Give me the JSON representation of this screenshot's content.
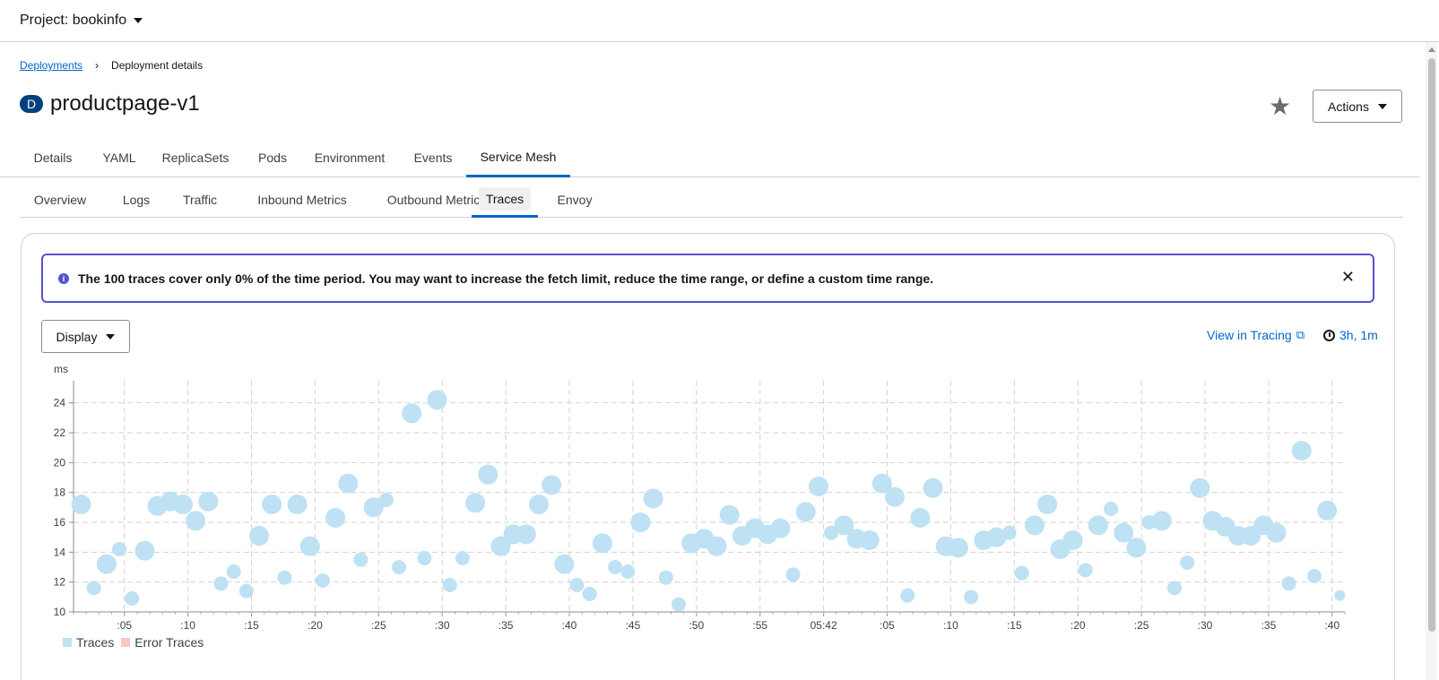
{
  "project": {
    "label": "Project: bookinfo"
  },
  "breadcrumb": {
    "parent": "Deployments",
    "current": "Deployment details"
  },
  "resource": {
    "badge": "D",
    "name": "productpage-v1"
  },
  "actions_label": "Actions",
  "tabs": [
    "Details",
    "YAML",
    "ReplicaSets",
    "Pods",
    "Environment",
    "Events",
    "Service Mesh"
  ],
  "active_tab": "Service Mesh",
  "subtabs": [
    "Overview",
    "Logs",
    "Traffic",
    "Inbound Metrics",
    "Outbound Metrics",
    "Traces",
    "Envoy"
  ],
  "active_subtab": "Traces",
  "alert": {
    "text": "The 100 traces cover only 0% of the time period. You may want to increase the fetch limit, reduce the time range, or define a custom time range."
  },
  "display_label": "Display",
  "tracing_link": "View in Tracing",
  "time_range": "3h, 1m",
  "colors": {
    "accent": "#0066cc",
    "alert_border": "#5752d1",
    "trace_point": "#bee1f4",
    "error_point": "#f9c5c5",
    "badge": "#004080"
  },
  "chart_data": {
    "type": "scatter",
    "ylabel": "ms",
    "ylim": [
      10,
      25
    ],
    "yticks": [
      10,
      12,
      14,
      16,
      18,
      20,
      22,
      24
    ],
    "xlim": [
      0,
      100
    ],
    "xticks": [
      {
        "pos": 4,
        "label": ":05"
      },
      {
        "pos": 9,
        "label": ":10"
      },
      {
        "pos": 14,
        "label": ":15"
      },
      {
        "pos": 19,
        "label": ":20"
      },
      {
        "pos": 24,
        "label": ":25"
      },
      {
        "pos": 29,
        "label": ":30"
      },
      {
        "pos": 34,
        "label": ":35"
      },
      {
        "pos": 39,
        "label": ":40"
      },
      {
        "pos": 44,
        "label": ":45"
      },
      {
        "pos": 49,
        "label": ":50"
      },
      {
        "pos": 54,
        "label": ":55"
      },
      {
        "pos": 59,
        "label": "05:42"
      },
      {
        "pos": 64,
        "label": ":05"
      },
      {
        "pos": 69,
        "label": ":10"
      },
      {
        "pos": 74,
        "label": ":15"
      },
      {
        "pos": 79,
        "label": ":20"
      },
      {
        "pos": 84,
        "label": ":25"
      },
      {
        "pos": 89,
        "label": ":30"
      },
      {
        "pos": 94,
        "label": ":35"
      },
      {
        "pos": 99,
        "label": ":40"
      }
    ],
    "legend": [
      "Traces",
      "Error Traces"
    ],
    "series": [
      {
        "name": "Traces",
        "points": [
          [
            0.6,
            17.2,
            2
          ],
          [
            1.6,
            11.6,
            1
          ],
          [
            2.6,
            13.2,
            2
          ],
          [
            3.6,
            14.2,
            1
          ],
          [
            4.6,
            10.9,
            1
          ],
          [
            5.6,
            14.1,
            2
          ],
          [
            6.6,
            17.1,
            2
          ],
          [
            7.6,
            17.4,
            2
          ],
          [
            8.6,
            17.2,
            2
          ],
          [
            9.6,
            16.1,
            2
          ],
          [
            10.6,
            17.4,
            2
          ],
          [
            11.6,
            11.9,
            1
          ],
          [
            12.6,
            12.7,
            1
          ],
          [
            13.6,
            11.4,
            1
          ],
          [
            14.6,
            15.1,
            2
          ],
          [
            15.6,
            17.2,
            2
          ],
          [
            16.6,
            12.3,
            1
          ],
          [
            17.6,
            17.2,
            2
          ],
          [
            18.6,
            14.4,
            2
          ],
          [
            19.6,
            12.1,
            1
          ],
          [
            20.6,
            16.3,
            2
          ],
          [
            21.6,
            18.6,
            2
          ],
          [
            22.6,
            13.5,
            1
          ],
          [
            23.6,
            17.0,
            2
          ],
          [
            24.6,
            17.5,
            1
          ],
          [
            25.6,
            13.0,
            1
          ],
          [
            26.6,
            23.3,
            2
          ],
          [
            27.6,
            13.6,
            1
          ],
          [
            28.6,
            24.2,
            2
          ],
          [
            29.6,
            11.8,
            1
          ],
          [
            30.6,
            13.6,
            1
          ],
          [
            31.6,
            17.3,
            2
          ],
          [
            32.6,
            19.2,
            2
          ],
          [
            33.6,
            14.4,
            2
          ],
          [
            34.6,
            15.2,
            2
          ],
          [
            35.6,
            15.2,
            2
          ],
          [
            36.6,
            17.2,
            2
          ],
          [
            37.6,
            18.5,
            2
          ],
          [
            38.6,
            13.2,
            2
          ],
          [
            39.6,
            11.8,
            1
          ],
          [
            40.6,
            11.2,
            1
          ],
          [
            41.6,
            14.6,
            2
          ],
          [
            42.6,
            13.0,
            1
          ],
          [
            43.6,
            12.7,
            1
          ],
          [
            44.6,
            16.0,
            2
          ],
          [
            45.6,
            17.6,
            2
          ],
          [
            46.6,
            12.3,
            1
          ],
          [
            47.6,
            10.5,
            1
          ],
          [
            48.6,
            14.6,
            2
          ],
          [
            49.6,
            14.9,
            2
          ],
          [
            50.6,
            14.4,
            2
          ],
          [
            51.6,
            16.5,
            2
          ],
          [
            52.6,
            15.1,
            2
          ],
          [
            53.6,
            15.6,
            2
          ],
          [
            54.6,
            15.2,
            2
          ],
          [
            55.6,
            15.6,
            2
          ],
          [
            56.6,
            12.5,
            1
          ],
          [
            57.6,
            16.7,
            2
          ],
          [
            58.6,
            18.4,
            2
          ],
          [
            59.6,
            15.3,
            1
          ],
          [
            60.6,
            15.8,
            2
          ],
          [
            61.6,
            14.9,
            2
          ],
          [
            62.6,
            14.8,
            2
          ],
          [
            63.6,
            18.6,
            2
          ],
          [
            64.6,
            17.7,
            2
          ],
          [
            65.6,
            11.1,
            1
          ],
          [
            66.6,
            16.3,
            2
          ],
          [
            67.6,
            18.3,
            2
          ],
          [
            68.6,
            14.4,
            2
          ],
          [
            69.6,
            14.3,
            2
          ],
          [
            70.6,
            11.0,
            1
          ],
          [
            71.6,
            14.8,
            2
          ],
          [
            72.6,
            15.0,
            2
          ],
          [
            73.6,
            15.3,
            1
          ],
          [
            74.6,
            12.6,
            1
          ],
          [
            75.6,
            15.8,
            2
          ],
          [
            76.6,
            17.2,
            2
          ],
          [
            77.6,
            14.2,
            2
          ],
          [
            78.6,
            14.8,
            2
          ],
          [
            79.6,
            12.8,
            1
          ],
          [
            80.6,
            15.8,
            2
          ],
          [
            81.6,
            16.9,
            1
          ],
          [
            82.6,
            15.3,
            2
          ],
          [
            83.6,
            14.3,
            2
          ],
          [
            84.6,
            16.0,
            1
          ],
          [
            85.6,
            16.1,
            2
          ],
          [
            86.6,
            11.6,
            1
          ],
          [
            87.6,
            13.3,
            1
          ],
          [
            88.6,
            18.3,
            2
          ],
          [
            89.6,
            16.1,
            2
          ],
          [
            90.6,
            15.7,
            2
          ],
          [
            91.6,
            15.1,
            2
          ],
          [
            92.6,
            15.1,
            2
          ],
          [
            93.6,
            15.8,
            2
          ],
          [
            94.6,
            15.3,
            2
          ],
          [
            95.6,
            11.9,
            1
          ],
          [
            96.6,
            20.8,
            2
          ],
          [
            97.6,
            12.4,
            1
          ],
          [
            98.6,
            16.8,
            2
          ],
          [
            99.6,
            11.1,
            0
          ]
        ]
      },
      {
        "name": "Error Traces",
        "points": []
      }
    ]
  }
}
